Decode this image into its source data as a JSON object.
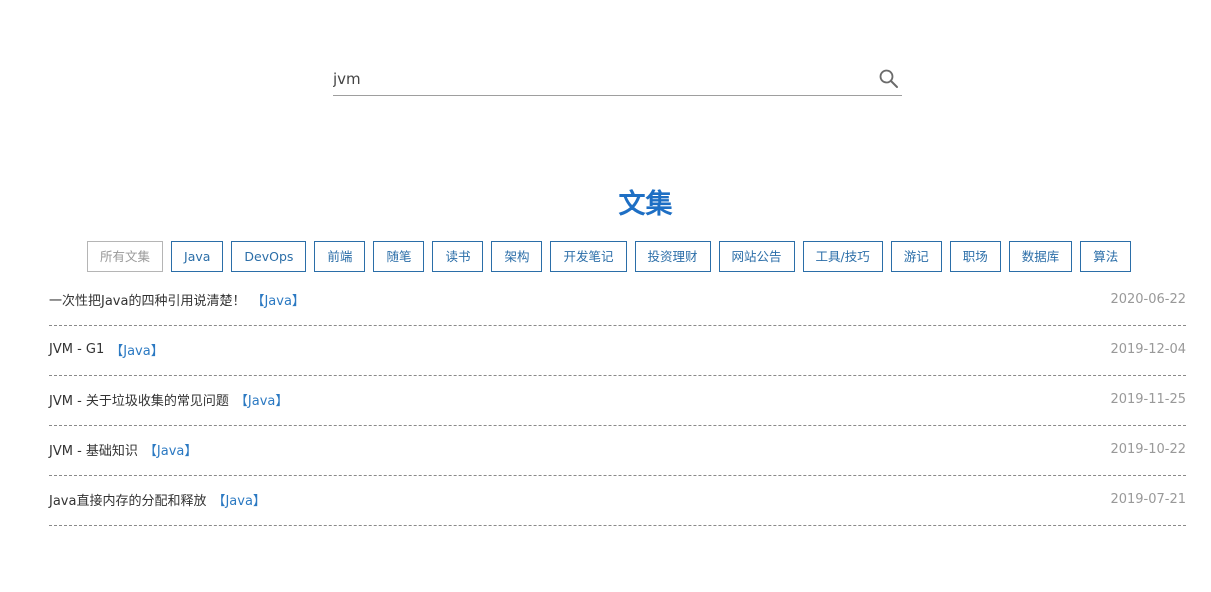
{
  "search": {
    "value": "jvm",
    "placeholder": ""
  },
  "page_title": "文集",
  "categories": [
    {
      "label": "所有文集",
      "active": true
    },
    {
      "label": "Java",
      "active": false
    },
    {
      "label": "DevOps",
      "active": false
    },
    {
      "label": "前端",
      "active": false
    },
    {
      "label": "随笔",
      "active": false
    },
    {
      "label": "读书",
      "active": false
    },
    {
      "label": "架构",
      "active": false
    },
    {
      "label": "开发笔记",
      "active": false
    },
    {
      "label": "投资理财",
      "active": false
    },
    {
      "label": "网站公告",
      "active": false
    },
    {
      "label": "工具/技巧",
      "active": false
    },
    {
      "label": "游记",
      "active": false
    },
    {
      "label": "职场",
      "active": false
    },
    {
      "label": "数据库",
      "active": false
    },
    {
      "label": "算法",
      "active": false
    }
  ],
  "articles": [
    {
      "title": "一次性把Java的四种引用说清楚！",
      "tag": "【Java】",
      "date": "2020-06-22"
    },
    {
      "title": "JVM - G1",
      "tag": "【Java】",
      "date": "2019-12-04"
    },
    {
      "title": "JVM - 关于垃圾收集的常见问题",
      "tag": "【Java】",
      "date": "2019-11-25"
    },
    {
      "title": "JVM - 基础知识",
      "tag": "【Java】",
      "date": "2019-10-22"
    },
    {
      "title": "Java直接内存的分配和释放",
      "tag": "【Java】",
      "date": "2019-07-21"
    }
  ],
  "colors": {
    "accent": "#1e6fc4",
    "tag_border": "#2b6ea8",
    "active_tag": "#999999",
    "date": "#999999"
  },
  "icons": {
    "search": "search-icon"
  }
}
